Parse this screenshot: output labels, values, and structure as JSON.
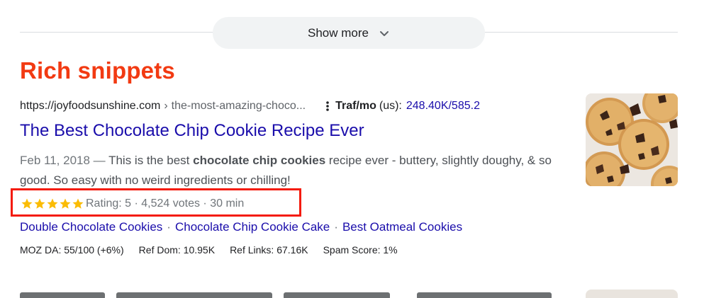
{
  "show_more": {
    "label": "Show more"
  },
  "heading": "Rich snippets",
  "result": {
    "url_host": "https://joyfoodsunshine.com",
    "url_sep": "›",
    "url_path": "the-most-amazing-choco...",
    "traffic": {
      "label": "Traf/mo",
      "paren": "(us):",
      "value": "248.40K/585.2"
    },
    "title": "The Best Chocolate Chip Cookie Recipe Ever",
    "snippet": {
      "date": "Feb 11, 2018 —",
      "text_before": " This is the best ",
      "bold": "chocolate chip cookies",
      "text_after": " recipe ever - buttery, slightly doughy, & so good. So easy with no weird ingredients or chilling!"
    },
    "rating": {
      "stars": 5,
      "text": "Rating: 5 · 4,524 votes · 30 min"
    },
    "sitelinks": [
      "Double Chocolate Cookies",
      "Chocolate Chip Cookie Cake",
      "Best Oatmeal Cookies"
    ],
    "sitelink_sep": "·",
    "metrics": {
      "moz_da": "MOZ DA: 55/100 (+6%)",
      "ref_dom": "Ref Dom: 10.95K",
      "ref_links": "Ref Links: 67.16K",
      "spam_score": "Spam Score: 1%"
    },
    "thumbnail": "cookie-photo"
  },
  "colors": {
    "heading": "#f23a12",
    "link": "#1a0dab",
    "highlight_box": "#f41b0c",
    "star": "#fbbc04"
  },
  "icons": {
    "show_more": "chevron-down-icon",
    "more_options": "kebab-icon",
    "rating": "star-icon"
  }
}
